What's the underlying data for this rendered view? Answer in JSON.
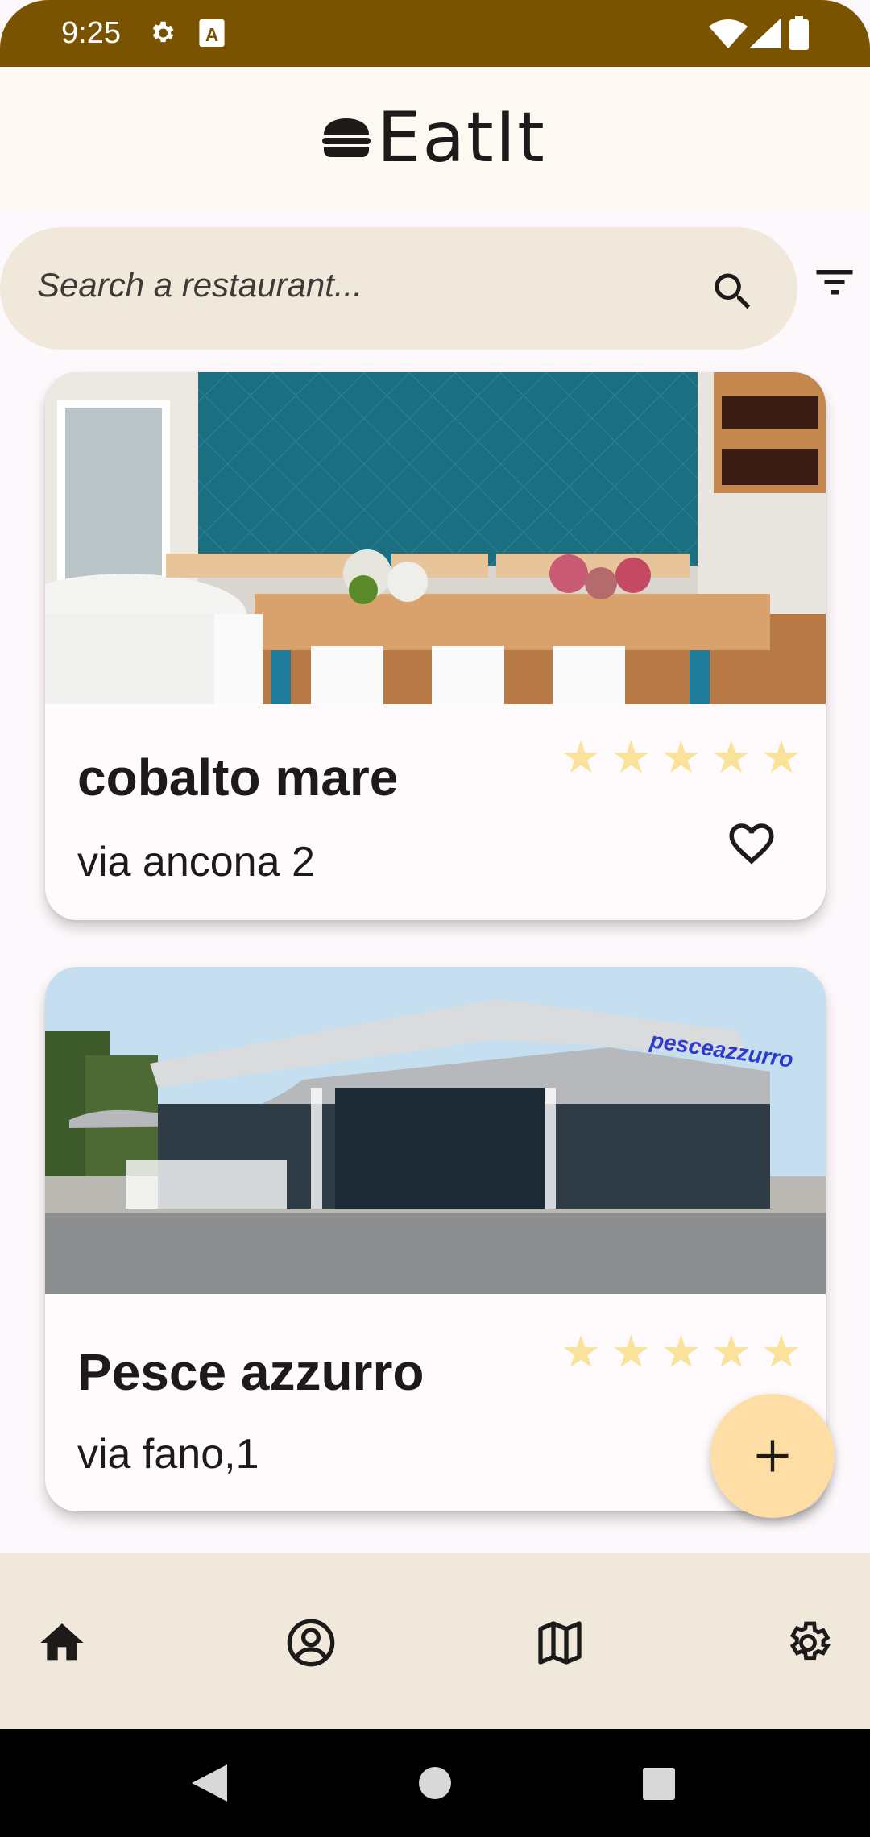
{
  "status_bar": {
    "time": "9:25",
    "icons": [
      "gear-icon",
      "a-icon",
      "wifi-icon",
      "signal-icon",
      "battery-icon"
    ]
  },
  "app": {
    "title": "EatIt",
    "logo_icon": "burger-icon"
  },
  "search": {
    "placeholder": "Search a restaurant...",
    "search_icon": "search-icon",
    "filter_icon": "filter-icon"
  },
  "restaurants": [
    {
      "name": "cobalto mare",
      "address": "via ancona 2",
      "rating": 5,
      "favorite": false,
      "image": "restaurant-interior-photo"
    },
    {
      "name": "Pesce azzurro",
      "address": "via fano,1",
      "rating": 5,
      "favorite": false,
      "image": "restaurant-exterior-photo",
      "sign_text": "pesceazzurro"
    }
  ],
  "fab": {
    "icon": "plus-icon"
  },
  "bottom_nav": {
    "items": [
      {
        "icon": "home-icon",
        "active": true
      },
      {
        "icon": "account-icon",
        "active": false
      },
      {
        "icon": "map-icon",
        "active": false
      },
      {
        "icon": "settings-icon",
        "active": false
      }
    ]
  },
  "colors": {
    "status_bar": "#7a5300",
    "app_bar": "#fdf8f1",
    "search_bg": "#f1e8dc",
    "star": "#fbe29a",
    "fab": "#ffdea6",
    "nav_bg": "#f1e8dc"
  }
}
